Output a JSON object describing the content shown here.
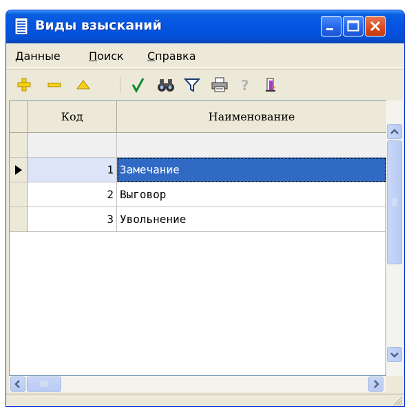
{
  "window": {
    "title": "Виды взысканий",
    "icon": "document-list-icon",
    "controls": [
      "minimize-icon",
      "maximize-icon",
      "close-icon"
    ]
  },
  "menu": {
    "items": [
      {
        "first": "Д",
        "rest": "анные"
      },
      {
        "first": "П",
        "rest": "оиск"
      },
      {
        "first": "С",
        "rest": "правка"
      }
    ]
  },
  "toolbar": {
    "buttons": [
      "add-icon",
      "delete-icon",
      "edit-icon",
      "checkmark-icon",
      "binoculars-icon",
      "filter-icon",
      "printer-icon",
      "help-icon",
      "exit-icon"
    ]
  },
  "grid": {
    "columns": [
      "Код",
      "Наименование"
    ],
    "rows": [
      {
        "code": "1",
        "name": "Замечание"
      },
      {
        "code": "2",
        "name": "Выговор"
      },
      {
        "code": "3",
        "name": "Увольнение"
      }
    ],
    "selected_index": 0
  },
  "colors": {
    "selection": "#316ac5",
    "titlebar": "#0555e3",
    "face": "#ece9d8"
  }
}
